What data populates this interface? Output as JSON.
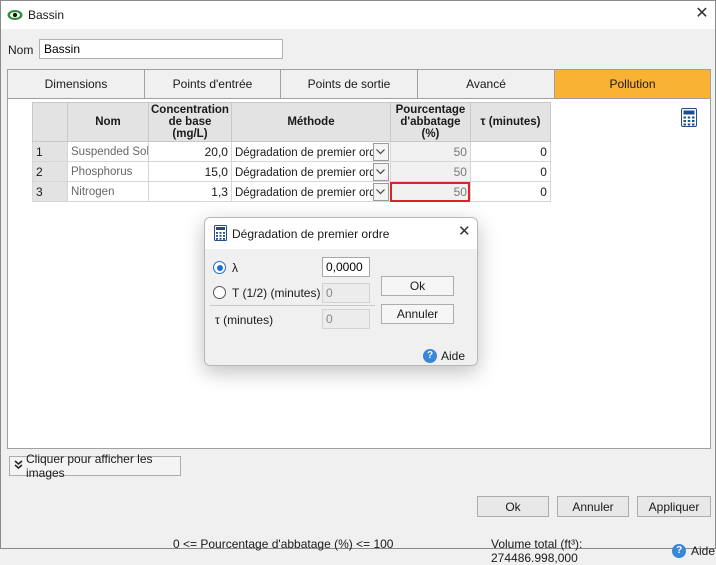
{
  "window": {
    "title": "Bassin"
  },
  "nom": {
    "label": "Nom",
    "value": "Bassin"
  },
  "tabs": [
    {
      "label": "Dimensions",
      "active": false
    },
    {
      "label": "Points d'entrée",
      "active": false
    },
    {
      "label": "Points de sortie",
      "active": false
    },
    {
      "label": "Avancé",
      "active": false
    },
    {
      "label": "Pollution",
      "active": true
    }
  ],
  "table": {
    "headers": {
      "name": "Nom",
      "conc_line1": "Concentration",
      "conc_line2": "de base",
      "conc_line3": "(mg/L)",
      "method": "Méthode",
      "pct_line1": "Pourcentage",
      "pct_line2": "d'abbatage",
      "pct_line3": "(%)",
      "tau": "τ (minutes)"
    },
    "rows": [
      {
        "num": "1",
        "name": "Suspended Solids",
        "conc": "20,0",
        "method": "Dégradation de premier ordre",
        "pct": "50",
        "tau": "0"
      },
      {
        "num": "2",
        "name": "Phosphorus",
        "conc": "15,0",
        "method": "Dégradation de premier ordre",
        "pct": "50",
        "tau": "0"
      },
      {
        "num": "3",
        "name": "Nitrogen",
        "conc": "1,3",
        "method": "Dégradation de premier ordre",
        "pct": "50",
        "tau": "0"
      }
    ]
  },
  "show_images": {
    "label": "Cliquer pour afficher les images"
  },
  "buttons": {
    "ok": "Ok",
    "cancel": "Annuler",
    "apply": "Appliquer"
  },
  "status": {
    "constraint": "0 <= Pourcentage d'abbatage (%) <= 100",
    "volume": "Volume total  (ft³): 274486.998,000",
    "help": "Aide"
  },
  "dialog": {
    "title": "Dégradation de premier ordre",
    "lambda_label": "λ",
    "lambda_value": "0,0000",
    "half_life_label": "T (1/2) (minutes)",
    "half_life_value": "0",
    "tau_label": "τ (minutes)",
    "tau_value": "0",
    "ok": "Ok",
    "cancel": "Annuler",
    "help": "Aide"
  },
  "colors": {
    "active_tab": "#f9b233",
    "selected_cell": "#d9232d",
    "accent": "#1d6fcf"
  }
}
